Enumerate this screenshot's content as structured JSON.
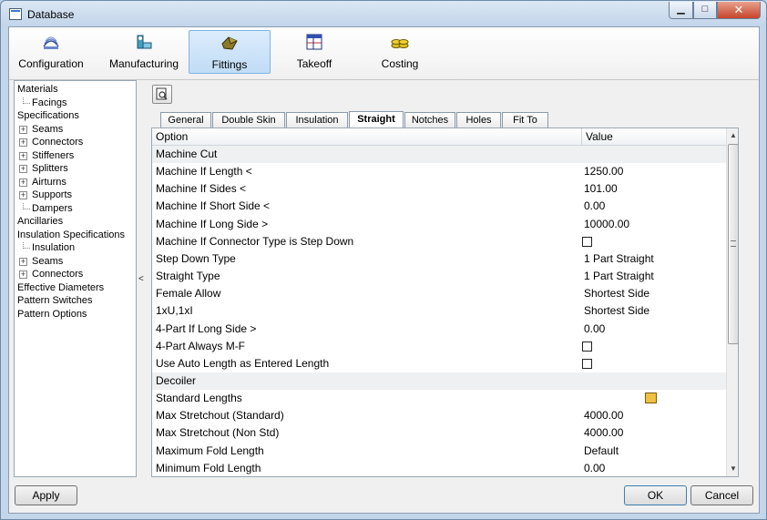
{
  "window": {
    "title": "Database",
    "min_glyph": "▁",
    "max_glyph": "□",
    "close_glyph": "✕"
  },
  "ribbon": [
    {
      "label": "Configuration",
      "icon": "configuration-icon",
      "active": false
    },
    {
      "label": "Manufacturing",
      "icon": "manufacturing-icon",
      "active": false
    },
    {
      "label": "Fittings",
      "icon": "fittings-icon",
      "active": true
    },
    {
      "label": "Takeoff",
      "icon": "takeoff-icon",
      "active": false
    },
    {
      "label": "Costing",
      "icon": "costing-icon",
      "active": false
    }
  ],
  "tree": [
    {
      "label": "Materials",
      "level": 0,
      "expander": false
    },
    {
      "label": "Facings",
      "level": 1,
      "expander": false
    },
    {
      "label": "Specifications",
      "level": 0,
      "expander": false
    },
    {
      "label": "Seams",
      "level": 1,
      "expander": true
    },
    {
      "label": "Connectors",
      "level": 1,
      "expander": true
    },
    {
      "label": "Stiffeners",
      "level": 1,
      "expander": true
    },
    {
      "label": "Splitters",
      "level": 1,
      "expander": true
    },
    {
      "label": "Airturns",
      "level": 1,
      "expander": true
    },
    {
      "label": "Supports",
      "level": 1,
      "expander": true
    },
    {
      "label": "Dampers",
      "level": 1,
      "expander": false
    },
    {
      "label": "Ancillaries",
      "level": 0,
      "expander": false
    },
    {
      "label": "Insulation Specifications",
      "level": 0,
      "expander": false
    },
    {
      "label": "Insulation",
      "level": 1,
      "expander": false
    },
    {
      "label": "Seams",
      "level": 1,
      "expander": true
    },
    {
      "label": "Connectors",
      "level": 1,
      "expander": true
    },
    {
      "label": "Effective Diameters",
      "level": 0,
      "expander": false
    },
    {
      "label": "Pattern Switches",
      "level": 0,
      "expander": false
    },
    {
      "label": "Pattern Options",
      "level": 0,
      "expander": false
    }
  ],
  "splitter_glyph": "<",
  "tabs": [
    {
      "label": "General",
      "active": false
    },
    {
      "label": "Double Skin",
      "active": false
    },
    {
      "label": "Insulation",
      "active": false
    },
    {
      "label": "Straight",
      "active": true
    },
    {
      "label": "Notches",
      "active": false
    },
    {
      "label": "Holes",
      "active": false
    },
    {
      "label": "Fit To",
      "active": false
    }
  ],
  "grid": {
    "headers": {
      "option": "Option",
      "value": "Value"
    },
    "rows": [
      {
        "type": "section",
        "option": "Machine Cut"
      },
      {
        "type": "text",
        "option": "Machine If Length <",
        "value": "1250.00"
      },
      {
        "type": "text",
        "option": "Machine If Sides <",
        "value": "101.00"
      },
      {
        "type": "text",
        "option": "Machine If Short Side <",
        "value": "0.00"
      },
      {
        "type": "text",
        "option": "Machine If Long Side >",
        "value": "10000.00"
      },
      {
        "type": "checkbox",
        "option": "Machine If Connector Type is Step Down",
        "checked": false
      },
      {
        "type": "text",
        "option": "Step Down Type",
        "value": "1 Part Straight"
      },
      {
        "type": "text",
        "option": "Straight Type",
        "value": "1 Part Straight"
      },
      {
        "type": "text",
        "option": "Female Allow",
        "value": "Shortest Side"
      },
      {
        "type": "text",
        "option": "1xU,1xI",
        "value": "Shortest Side"
      },
      {
        "type": "text",
        "option": "4-Part If Long Side >",
        "value": "0.00"
      },
      {
        "type": "checkbox",
        "option": "4-Part Always M-F",
        "checked": false
      },
      {
        "type": "checkbox",
        "option": "Use Auto Length as Entered Length",
        "checked": false
      },
      {
        "type": "section",
        "option": "Decoiler"
      },
      {
        "type": "browse",
        "option": "Standard Lengths"
      },
      {
        "type": "text",
        "option": "Max Stretchout (Standard)",
        "value": "4000.00"
      },
      {
        "type": "text",
        "option": "Max Stretchout (Non Std)",
        "value": "4000.00"
      },
      {
        "type": "text",
        "option": "Maximum Fold Length",
        "value": "Default"
      },
      {
        "type": "text",
        "option": "Minimum Fold Length",
        "value": "0.00"
      }
    ]
  },
  "buttons": {
    "apply": "Apply",
    "ok": "OK",
    "cancel": "Cancel"
  }
}
